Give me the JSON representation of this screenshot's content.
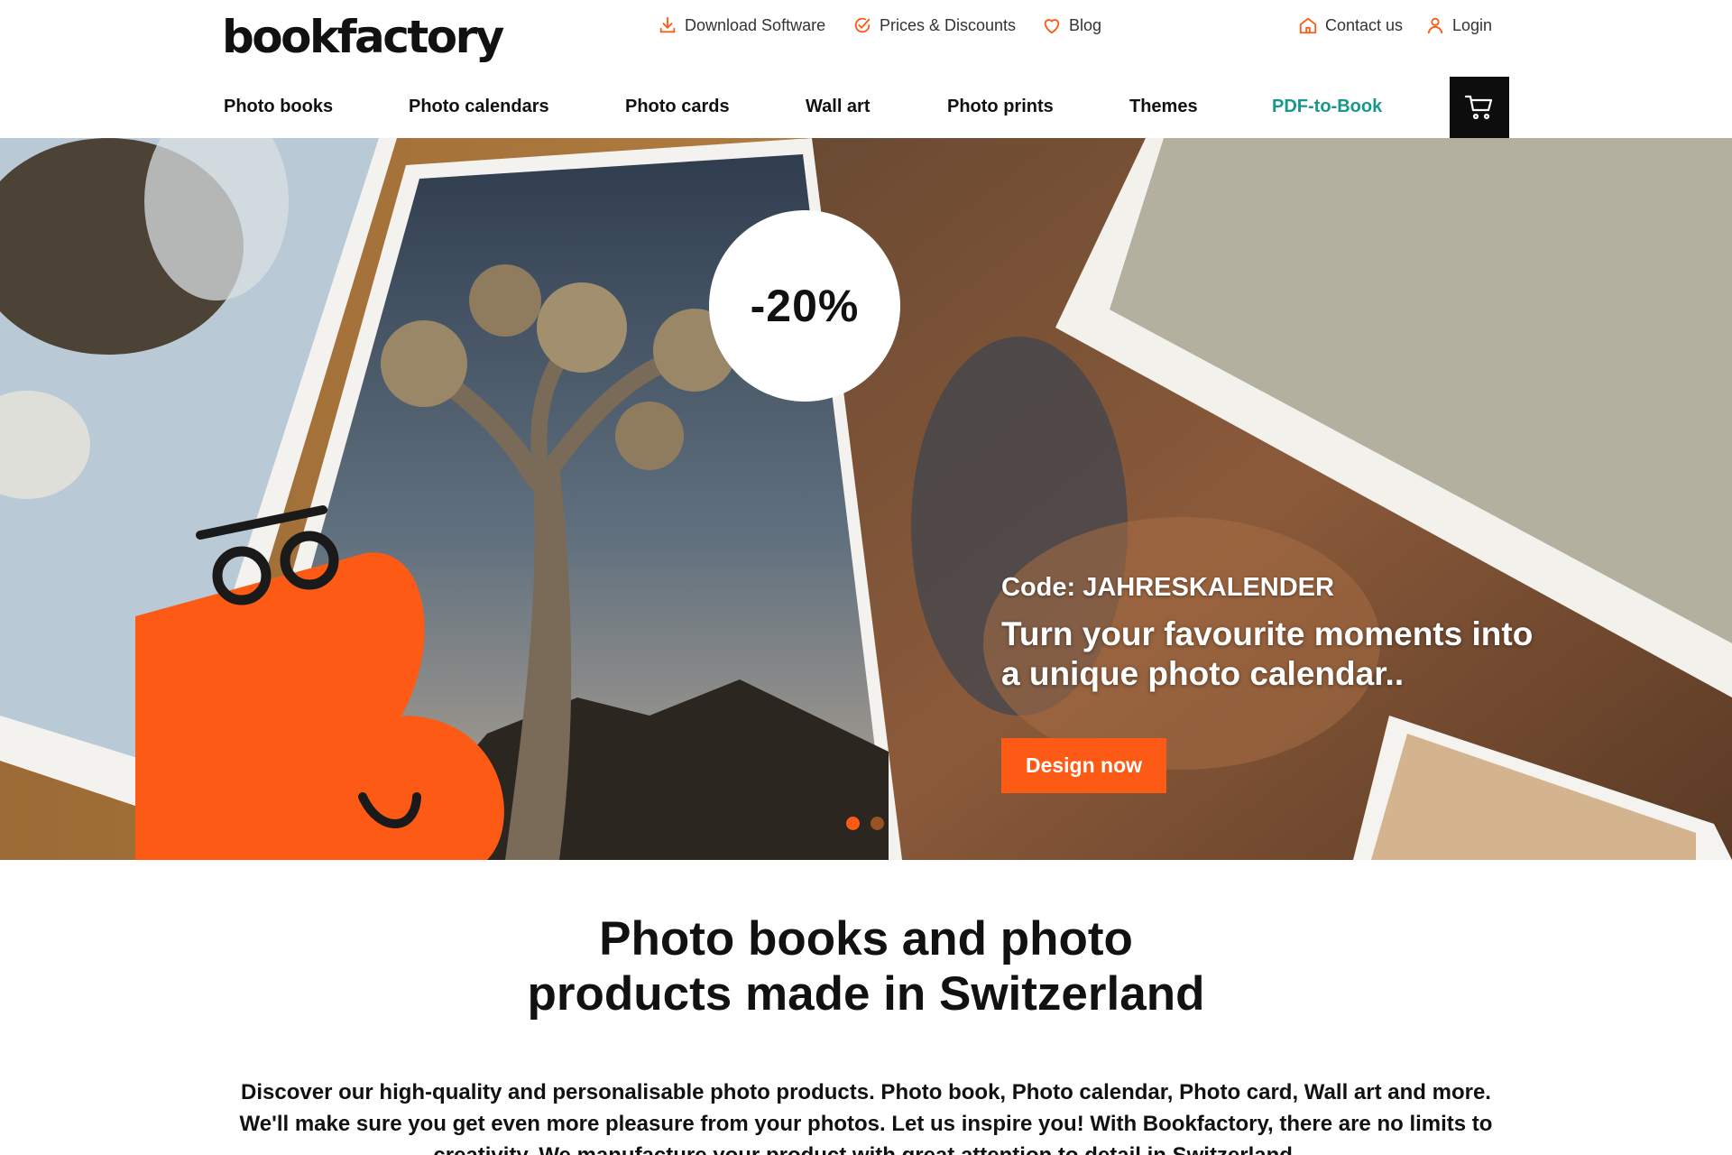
{
  "header": {
    "logo": "bookfactory",
    "utility": {
      "download": "Download Software",
      "prices": "Prices & Discounts",
      "blog": "Blog",
      "contact": "Contact us",
      "login": "Login"
    },
    "nav": {
      "photo_books": "Photo books",
      "photo_calendars": "Photo calendars",
      "photo_cards": "Photo cards",
      "wall_art": "Wall art",
      "photo_prints": "Photo prints",
      "themes": "Themes",
      "pdf_to_book": "PDF-to-Book"
    },
    "accent_color": "#fd5a15",
    "pdf_color": "#17988a"
  },
  "hero": {
    "discount": "-20%",
    "code": "Code: JAHRESKALENDER",
    "headline": "Turn your favourite moments into a unique photo calendar..",
    "cta": "Design now",
    "slides": 2,
    "active_slide": 1
  },
  "intro": {
    "title": "Photo books and photo products made in Switzerland",
    "text": "Discover our high-quality and personalisable photo products. Photo book, Photo calendar, Photo card, Wall art and more. We'll make sure you get even more pleasure from your photos. Let us inspire you! With Bookfactory, there are no limits to creativity. We manufacture your product with great attention to detail in Switzerland."
  }
}
